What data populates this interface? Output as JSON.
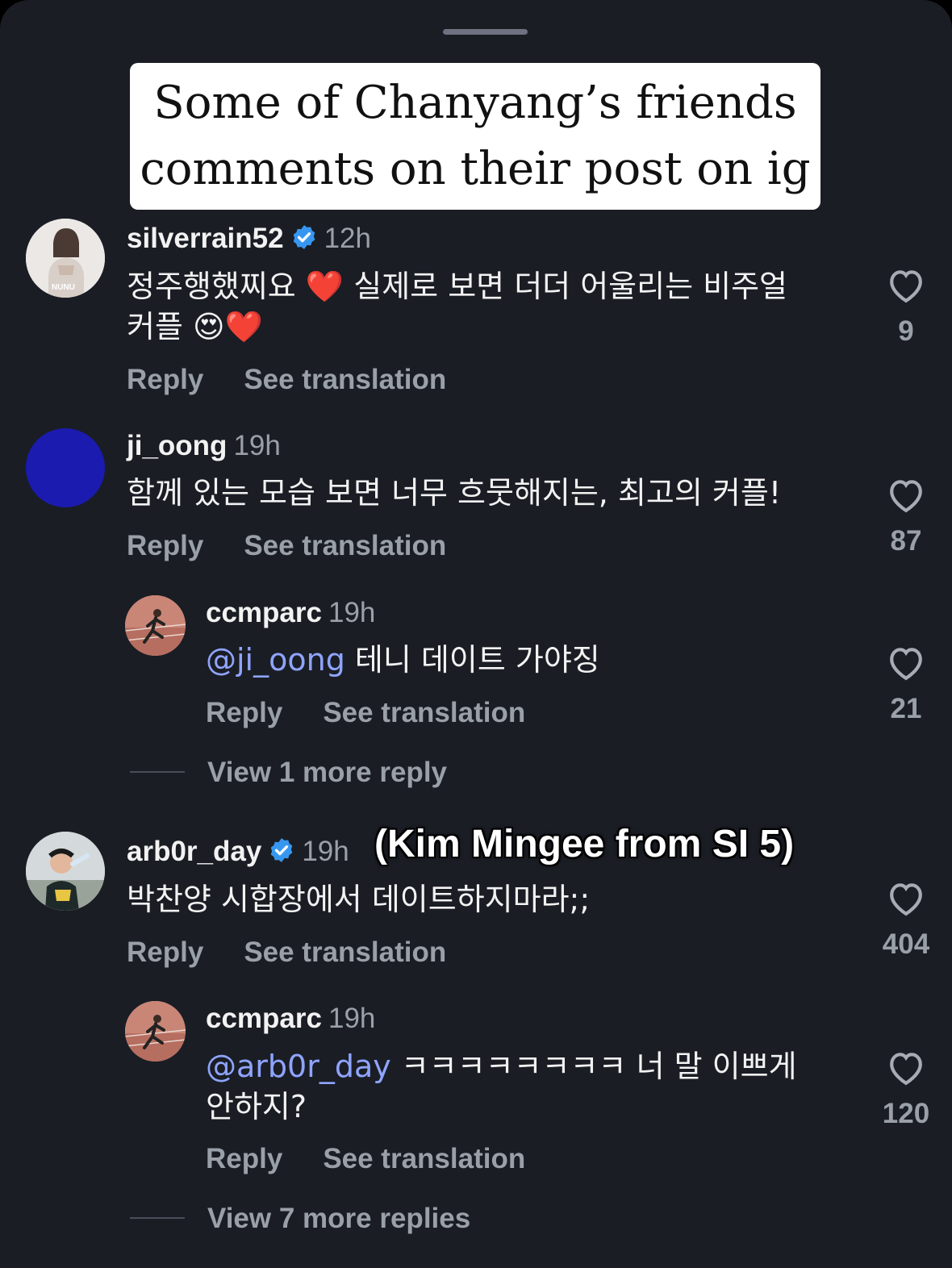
{
  "title_card": {
    "line1": "Some of Chanyang’s friends",
    "line2": "comments on their post on ig"
  },
  "overlay_caption": "(Kim Mingee from SI 5)",
  "colors": {
    "background": "#1a1d24",
    "verified": "#3797f0",
    "mention": "#8fa4ff",
    "heart": "#e0242e"
  },
  "comments": [
    {
      "username": "silverrain52",
      "verified": true,
      "time": "12h",
      "text_line1": "정주행했찌요 ❤️ 실제로 보면 더더 어울리는 비주얼",
      "text_line2": "커플 😍❤️",
      "reply_label": "Reply",
      "translate_label": "See translation",
      "likes": "9",
      "avatar_icon": "profile-photo-icon",
      "avatar_watermark": "NUNU"
    },
    {
      "username": "ji_oong",
      "verified": false,
      "time": "19h",
      "text_line1": "함께 있는 모습 보면 너무 흐뭇해지는, 최고의 커플!",
      "reply_label": "Reply",
      "translate_label": "See translation",
      "likes": "87",
      "avatar_color": "#1b1bb0",
      "replies": [
        {
          "username": "ccmparc",
          "time": "19h",
          "mention": "@ji_oong",
          "text_line1": " 테니 데이트 가야징",
          "reply_label": "Reply",
          "translate_label": "See translation",
          "likes": "21"
        }
      ],
      "view_more": "View 1 more reply"
    },
    {
      "username": "arb0r_day",
      "verified": true,
      "time": "19h",
      "text_line1": "박찬양 시합장에서 데이트하지마라;;",
      "reply_label": "Reply",
      "translate_label": "See translation",
      "likes": "404",
      "replies": [
        {
          "username": "ccmparc",
          "time": "19h",
          "mention": "@arb0r_day",
          "text_line1": " ㅋㅋㅋㅋㅋㅋㅋㅋ 너 말 이쁘게",
          "text_line2": "안하지?",
          "reply_label": "Reply",
          "translate_label": "See translation",
          "likes": "120"
        }
      ],
      "view_more": "View 7 more replies"
    }
  ]
}
